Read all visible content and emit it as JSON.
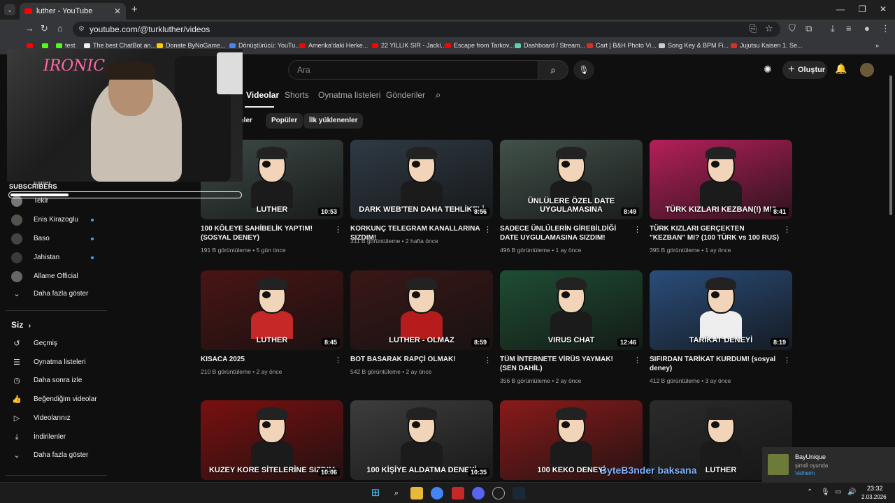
{
  "browser": {
    "tab_title": "luther - YouTube",
    "tab_close": "✕",
    "new_tab": "+",
    "url": "youtube.com/@turkluther/videos",
    "bookmarks": [
      {
        "label": "",
        "color": "#ff0000"
      },
      {
        "label": "",
        "color": "#53fc18"
      },
      {
        "label": "test",
        "color": "#53fc18"
      },
      {
        "label": "The best ChatBot an...",
        "color": "#eeeeee"
      },
      {
        "label": "Donate ByNoGame...",
        "color": "#ffcc00"
      },
      {
        "label": "Dönüştürücü: YouTu...",
        "color": "#4285f4"
      },
      {
        "label": "Amerika'daki Herke...",
        "color": "#ff0000"
      },
      {
        "label": "22 YILLIK SIR - Jacki...",
        "color": "#ff0000"
      },
      {
        "label": "Escape from Tarkov...",
        "color": "#ff0000"
      },
      {
        "label": "Dashboard / Stream...",
        "color": "#5ecfb0"
      },
      {
        "label": "Cart | B&H Photo Vi...",
        "color": "#d93025"
      },
      {
        "label": "Song Key & BPM Fi...",
        "color": "#cccccc"
      },
      {
        "label": "Jujutsu Kaisen 1. Se...",
        "color": "#d93025"
      }
    ]
  },
  "header": {
    "search_placeholder": "Ara",
    "create_label": "Oluştur"
  },
  "channel_tabs": [
    "Videolar",
    "Shorts",
    "Oynatma listeleri",
    "Gönderiler"
  ],
  "chips": [
    "enler",
    "Popüler",
    "İlk yüklenenler"
  ],
  "sidebar": {
    "subscriptions_partial": "luther",
    "subscriptions": [
      {
        "label": "Tekir",
        "color": "#777777",
        "dot": false
      },
      {
        "label": "Enis Kirazoglu",
        "color": "#55524d",
        "dot": true
      },
      {
        "label": "Baso",
        "color": "#444444",
        "dot": true
      },
      {
        "label": "Jahistan",
        "color": "#3a3a3a",
        "dot": true
      },
      {
        "label": "Allame Official",
        "color": "#666666",
        "dot": false
      }
    ],
    "show_more": "Daha fazla göster",
    "you_heading": "Siz",
    "you_items": [
      {
        "label": "Geçmiş",
        "icon": "↺"
      },
      {
        "label": "Oynatma listeleri",
        "icon": "☰"
      },
      {
        "label": "Daha sonra izle",
        "icon": "◷"
      },
      {
        "label": "Beğendiğim videolar",
        "icon": "👍"
      },
      {
        "label": "Videolarınız",
        "icon": "▷"
      },
      {
        "label": "İndirilenler",
        "icon": "⤓"
      },
      {
        "label": "Daha fazla göster",
        "icon": "⌄"
      }
    ]
  },
  "overlay": {
    "neon_sign": "IRONIC",
    "subscribers_label": "SUBSCRIBERS",
    "subscribers_progress": 0.25
  },
  "videos": [
    {
      "title": "100 KÖLEYE SAHİBELİK YAPTIM! (SOSYAL DENEY)",
      "views": "191 B görüntüleme",
      "age": "5 gün önce",
      "duration": "10:53",
      "thumb_text": "LUTHER",
      "bg": "#3d4a47",
      "shirt": "#1b1b1b"
    },
    {
      "title": "KORKUNÇ TELEGRAM KANALLARINA SIZDIM!",
      "views": "311 B görüntüleme",
      "age": "2 hafta önce",
      "duration": "8:56",
      "thumb_text": "DARK WEB'TEN DAHA TEHLİKELİ",
      "bg": "#2f3a44",
      "shirt": "#1b1b1b"
    },
    {
      "title": "SADECE ÜNLÜLERİN GİREBİLDİĞİ DATE UYGULAMASINA SIZDIM!",
      "views": "496 B görüntüleme",
      "age": "1 ay önce",
      "duration": "8:49",
      "thumb_text": "ÜNLÜLERE ÖZEL DATE UYGULAMASINA",
      "bg": "#42514a",
      "shirt": "#1b1b1b"
    },
    {
      "title": "TÜRK KIZLARI GERÇEKTEN \"KEZBAN\" MI? (100 TÜRK vs 100 RUS)",
      "views": "395 B görüntüleme",
      "age": "1 ay önce",
      "duration": "8:41",
      "thumb_text": "TÜRK KIZLARI KEZBAN(!) MI?",
      "bg": "#b51f5a",
      "shirt": "#1b1b1b"
    },
    {
      "title": "KISACA 2025",
      "views": "210 B görüntüleme",
      "age": "2 ay önce",
      "duration": "8:45",
      "thumb_text": "LUTHER",
      "bg": "#4a1414",
      "shirt": "#c62828"
    },
    {
      "title": "BOT BASARAK RAPÇİ OLMAK!",
      "views": "542 B görüntüleme",
      "age": "2 ay önce",
      "duration": "8:59",
      "thumb_text": "LUTHER - OLMAZ",
      "bg": "#3a1717",
      "shirt": "#b71c1c"
    },
    {
      "title": "TÜM İNTERNETE VİRÜS YAYMAK! (SEN DAHİL)",
      "views": "356 B görüntüleme",
      "age": "2 ay önce",
      "duration": "12:46",
      "thumb_text": "VIRUS CHAT",
      "bg": "#1f4d33",
      "shirt": "#1b1b1b"
    },
    {
      "title": "SIFIRDAN TARİKAT KURDUM! (sosyal deney)",
      "views": "412 B görüntüleme",
      "age": "3 ay önce",
      "duration": "8:19",
      "thumb_text": "TARİKAT DENEYİ",
      "bg": "#2a4d7a",
      "shirt": "#eeeeee"
    },
    {
      "title": "",
      "views": "",
      "age": "",
      "duration": "10:06",
      "thumb_text": "KUZEY KORE SİTELERİNE SIZDIM",
      "bg": "#7a1010",
      "shirt": "#1b1b1b"
    },
    {
      "title": "",
      "views": "",
      "age": "",
      "duration": "10:35",
      "thumb_text": "100 KİŞİYE ALDATMA DENEYİ",
      "bg": "#3d3d3d",
      "shirt": "#1b1b1b"
    },
    {
      "title": "",
      "views": "",
      "age": "",
      "duration": "",
      "thumb_text": "100 KEKO DENEYİ",
      "bg": "#8a1a1a",
      "shirt": "#1b1b1b"
    },
    {
      "title": "",
      "views": "",
      "age": "",
      "duration": "",
      "thumb_text": "LUTHER",
      "bg": "#2b2b2b",
      "shirt": "#1b1b1b"
    }
  ],
  "stream_overlay_text": "ByteB3nder baksana",
  "notification": {
    "name": "BayUnique",
    "status": "şimdi oyunda",
    "game": "Valheim"
  },
  "taskbar": {
    "time": "23:32",
    "date": "2.03.2026"
  }
}
